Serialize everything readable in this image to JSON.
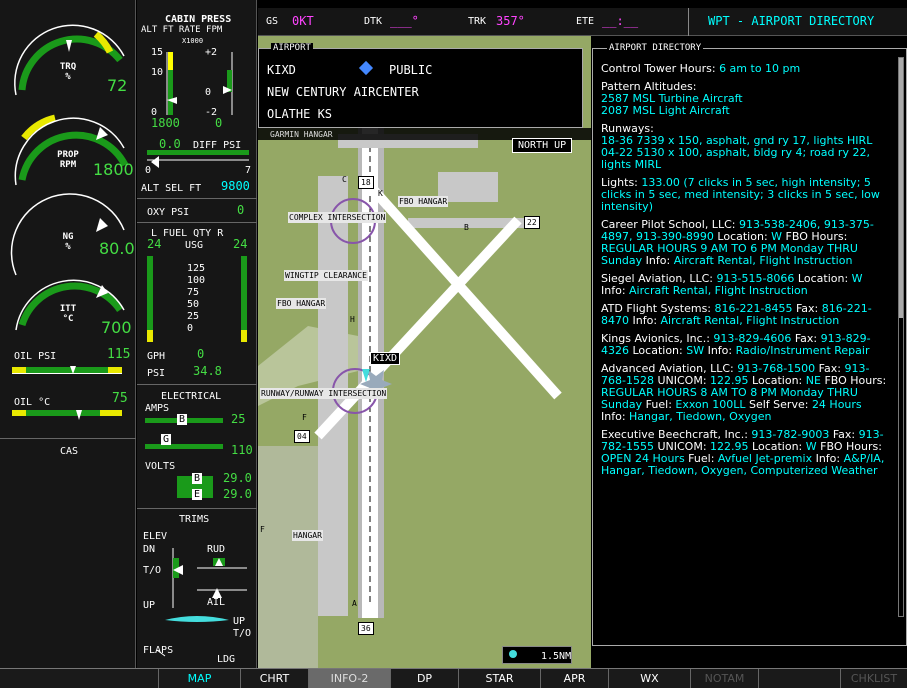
{
  "engine": {
    "trq": {
      "label": "TRQ",
      "unit": "%",
      "value": "72"
    },
    "prop": {
      "label": "PROP",
      "unit": "RPM",
      "value": "1800"
    },
    "ng": {
      "label": "NG",
      "unit": "%",
      "value": "80.0"
    },
    "itt": {
      "label": "ITT",
      "unit": "°C",
      "value": "700"
    },
    "oil_psi": {
      "label": "OIL PSI",
      "value": "115"
    },
    "oil_c": {
      "label": "OIL °C",
      "value": "75"
    },
    "cas": "CAS"
  },
  "cabin": {
    "title": "CABIN PRESS",
    "sub": "ALT FT  RATE FPM",
    "mult": "X1000",
    "t15": "15",
    "t10": "10",
    "t0": "0",
    "p2": "+2",
    "m2": "-2",
    "z": "0",
    "alt_val": "1800",
    "rate_val": "0",
    "diff_val": "0.0",
    "diff_label": "DIFF PSI",
    "d0": "0",
    "d7": "7",
    "altsel_label": "ALT SEL FT",
    "altsel_val": "9800"
  },
  "oxy": {
    "label": "OXY PSI",
    "value": "0"
  },
  "fuel": {
    "title": "L  FUEL QTY  R",
    "l": "24",
    "usg": "USG",
    "r": "24",
    "ticks": [
      "125",
      "100",
      "75",
      "50",
      "25",
      "0"
    ],
    "gph_label": "GPH",
    "gph_val": "0",
    "psi_label": "PSI",
    "psi_val": "34.8"
  },
  "electrical": {
    "title": "ELECTRICAL",
    "amps": "AMPS",
    "b": "B",
    "g": "G",
    "amps_b": "25",
    "amps_g": "110",
    "volts": "VOLTS",
    "volts_b": "29.0",
    "volts_e": "29.0",
    "be": "B",
    "ee": "E"
  },
  "trims": {
    "title": "TRIMS",
    "elev": "ELEV",
    "dn": "DN",
    "to": "T/O",
    "up": "UP",
    "rud": "RUD",
    "ail": "AIL",
    "up2": "UP",
    "to2": "T/O",
    "flaps": "FLAPS",
    "ldg": "LDG"
  },
  "topbar": {
    "gs_label": "GS",
    "gs_val": "0KT",
    "dtk_label": "DTK",
    "dtk_val": "___°",
    "trk_label": "TRK",
    "trk_val": "357°",
    "ete_label": "ETE",
    "ete_val": "__:__",
    "page_title": "WPT - AIRPORT DIRECTORY"
  },
  "airport": {
    "box_title": "AIRPORT",
    "ident": "KIXD",
    "type": "PUBLIC",
    "name": "NEW CENTURY AIRCENTER",
    "city": "OLATHE KS"
  },
  "map": {
    "orientation": "NORTH UP",
    "scale": "1.5NM",
    "labels": {
      "garmin_hangar": "GARMIN HANGAR",
      "complex": "COMPLEX INTERSECTION",
      "fbo_hangar_top": "FBO HANGAR",
      "wingtip": "WINGTIP CLEARANCE",
      "fbo_hangar_left": "FBO HANGAR",
      "runway": "RUNWAY/RUNWAY INTERSECTION",
      "hangar": "HANGAR",
      "kixd": "KIXD",
      "r18": "18",
      "r22": "22",
      "r04": "04",
      "r36": "36",
      "tw_c": "C",
      "tw_k": "K",
      "tw_b": "B",
      "tw_h": "H",
      "tw_f": "F",
      "tw_a": "A",
      "tw_f2": "F"
    }
  },
  "directory": {
    "box_title": "AIRPORT DIRECTORY",
    "entries": [
      {
        "h": "Control Tower Hours: ",
        "v": "6 am to 10 pm"
      },
      {
        "h": "Pattern Altitudes:",
        "v": "2587 MSL Turbine Aircraft\n2087 MSL Light Aircraft"
      },
      {
        "h": "Runways:",
        "v": "18-36 7339 x 150, asphalt, gnd ry 17, lights HIRL\n04-22 5130 x 100, asphalt, bldg ry 4; road ry 22, lights MIRL"
      },
      {
        "h": "Lights: ",
        "v": "133.00 (7 clicks in 5 sec, high intensity; 5 clicks in 5 sec, med intensity; 3 clicks in 5 sec, low intensity)"
      },
      {
        "h": "Career Pilot School, LLC: ",
        "v": "913-538-2406, 913-375-4897, 913-390-8990",
        "h2": " Location: ",
        "v2": "W",
        "h3": " FBO Hours: ",
        "v3": "REGULAR HOURS 9 AM TO 6 PM Monday THRU Sunday",
        "h4": " Info: ",
        "v4": "Aircraft Rental, Flight Instruction"
      },
      {
        "h": "Siegel Aviation, LLC: ",
        "v": "913-515-8066",
        "h2": " Location: ",
        "v2": "W",
        "h3": " Info: ",
        "v3": "Aircraft Rental, Flight Instruction"
      },
      {
        "h": "ATD Flight Systems: ",
        "v": "816-221-8455",
        "h2": " Fax: ",
        "v2": "816-221-8470",
        "h3": " Info: ",
        "v3": "Aircraft Rental, Flight Instruction"
      },
      {
        "h": "Kings Avionics, Inc.: ",
        "v": "913-829-4606",
        "h2": " Fax: ",
        "v2": "913-829-4326",
        "h3": " Location: ",
        "v3": "SW",
        "h4": " Info: ",
        "v4": "Radio/Instrument Repair"
      },
      {
        "h": "Advanced Aviation, LLC: ",
        "v": "913-768-1500",
        "h2": " Fax: ",
        "v2": "913-768-1528",
        "h3": " UNICOM: ",
        "v3": "122.95",
        "h4": " Location: ",
        "v4": "NE",
        "h5": " FBO Hours: ",
        "v5": "REGULAR HOURS 8 AM TO 8 PM Monday THRU Sunday",
        "h6": " Fuel: ",
        "v6": "Exxon 100LL",
        "h7": " Self Serve: ",
        "v7": "24 Hours",
        "h8": " Info: ",
        "v8": "Hangar, Tiedown, Oxygen"
      },
      {
        "h": "Executive Beechcraft, Inc.: ",
        "v": "913-782-9003",
        "h2": " Fax: ",
        "v2": "913-782-1555",
        "h3": " UNICOM: ",
        "v3": "122.95",
        "h4": " Location: ",
        "v4": "W",
        "h5": " FBO Hours: ",
        "v5": "OPEN 24 Hours",
        "h6": " Fuel: ",
        "v6": "Avfuel Jet-premix",
        "h7": " Info: ",
        "v7": "A&P/IA, Hangar, Tiedown, Oxygen, Computerized Weather"
      }
    ]
  },
  "softkeys": [
    "",
    "MAP",
    "CHRT",
    "INFO-2",
    "DP",
    "STAR",
    "APR",
    "WX",
    "NOTAM",
    "",
    "CHKLIST"
  ]
}
